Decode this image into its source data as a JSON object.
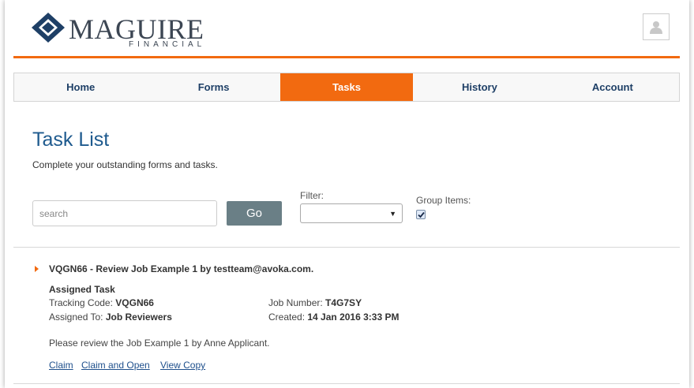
{
  "brand": {
    "name": "MAGUIRE",
    "tagline": "FINANCIAL"
  },
  "colors": {
    "accent": "#f26a10",
    "brand_navy": "#1e5a8e",
    "link": "#1e4f8c",
    "button": "#6a7f86"
  },
  "header": {
    "user_icon": "user-silhouette-icon"
  },
  "nav": {
    "items": [
      {
        "label": "Home",
        "active": false
      },
      {
        "label": "Forms",
        "active": false
      },
      {
        "label": "Tasks",
        "active": true
      },
      {
        "label": "History",
        "active": false
      },
      {
        "label": "Account",
        "active": false
      }
    ]
  },
  "page": {
    "title": "Task List",
    "subtitle": "Complete your outstanding forms and tasks."
  },
  "search": {
    "placeholder": "search",
    "value": "",
    "go_label": "Go"
  },
  "filter": {
    "label": "Filter:",
    "selected": ""
  },
  "group_items": {
    "label": "Group Items:",
    "checked": true
  },
  "task": {
    "title": "VQGN66 - Review Job Example 1 by testteam@avoka.com.",
    "type": "Assigned Task",
    "tracking_code_label": "Tracking Code:",
    "tracking_code": "VQGN66",
    "assigned_to_label": "Assigned To:",
    "assigned_to": "Job Reviewers",
    "job_number_label": "Job Number:",
    "job_number": "T4G7SY",
    "created_label": "Created:",
    "created": "14 Jan 2016 3:33 PM",
    "description": "Please review the Job Example 1 by Anne Applicant.",
    "actions": [
      "Claim",
      "Claim and Open",
      "View Copy"
    ]
  }
}
